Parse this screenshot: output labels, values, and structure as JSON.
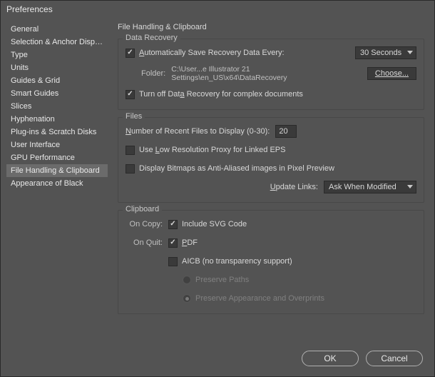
{
  "window": {
    "title": "Preferences"
  },
  "sidebar": {
    "items": [
      "General",
      "Selection & Anchor Display",
      "Type",
      "Units",
      "Guides & Grid",
      "Smart Guides",
      "Slices",
      "Hyphenation",
      "Plug-ins & Scratch Disks",
      "User Interface",
      "GPU Performance",
      "File Handling & Clipboard",
      "Appearance of Black"
    ],
    "selected": 11
  },
  "main": {
    "title": "File Handling & Clipboard",
    "data_recovery": {
      "legend": "Data Recovery",
      "auto_save_pre": "A",
      "auto_save_post": "utomatically Save Recovery Data Every:",
      "interval": "30 Seconds",
      "folder_label": "Folder:",
      "folder_path": "C:\\User...e Illustrator 21 Settings\\en_US\\x64\\DataRecovery",
      "choose_pre": "Ch",
      "choose_u": "o",
      "choose_post": "ose...",
      "turnoff_pre": "Turn off Dat",
      "turnoff_u": "a",
      "turnoff_post": " Recovery for complex documents"
    },
    "files": {
      "legend": "Files",
      "recent_pre": "N",
      "recent_post": "umber of Recent Files to Display (0-30):",
      "recent_val": "20",
      "lowres_pre": "Use ",
      "lowres_u": "L",
      "lowres_post": "ow Resolution Proxy for Linked EPS",
      "bitmaps": "Display Bitmaps as Anti-Aliased images in Pixel Preview",
      "update_pre": "U",
      "update_post": "pdate Links:",
      "update_val": "Ask When Modified"
    },
    "clipboard": {
      "legend": "Clipboard",
      "on_copy": "On Copy:",
      "include_svg": "Include SVG Code",
      "on_quit": "On Quit:",
      "pdf_u": "P",
      "pdf_post": "DF",
      "aicb": "AICB (no transparency support)",
      "preserve_paths": "Preserve Paths",
      "preserve_appearance": "Preserve Appearance and Overprints"
    }
  },
  "footer": {
    "ok": "OK",
    "cancel": "Cancel"
  }
}
